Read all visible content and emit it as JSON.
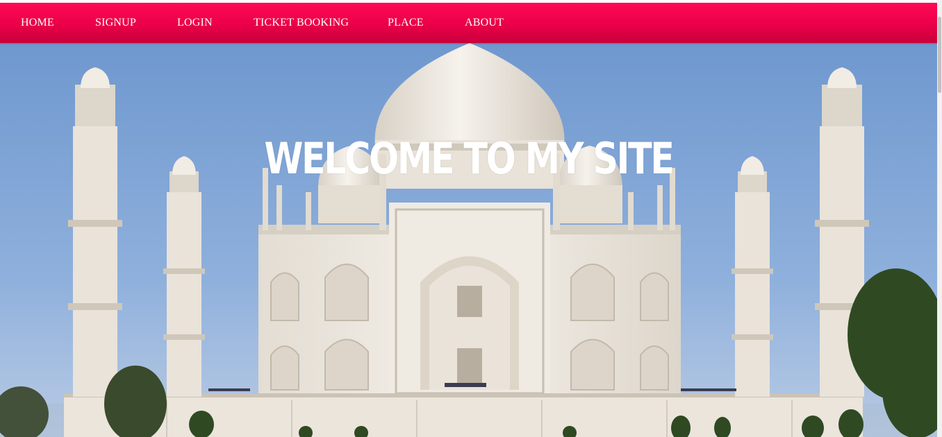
{
  "nav": {
    "items": [
      {
        "label": "HOME"
      },
      {
        "label": "SIGNUP"
      },
      {
        "label": "LOGIN"
      },
      {
        "label": "TICKET BOOKING"
      },
      {
        "label": "PLACE"
      },
      {
        "label": "ABOUT"
      }
    ]
  },
  "hero": {
    "title": "WELCOME TO MY SITE",
    "image": "taj-mahal-photo"
  },
  "colors": {
    "nav_bg": "#ea0049",
    "nav_text": "#ffffff",
    "sky": "#7fa6d8",
    "marble": "#ece6dc"
  }
}
